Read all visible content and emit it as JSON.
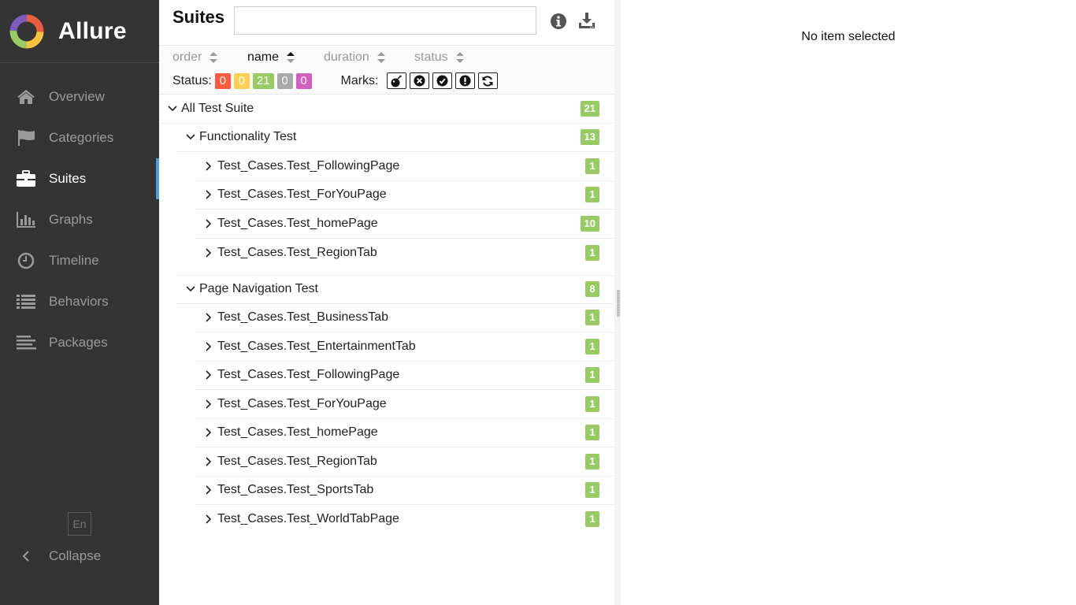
{
  "app": {
    "name": "Allure"
  },
  "sidebar": {
    "items": [
      {
        "label": "Overview",
        "icon": "home-icon",
        "active": false
      },
      {
        "label": "Categories",
        "icon": "flag-icon",
        "active": false
      },
      {
        "label": "Suites",
        "icon": "briefcase-icon",
        "active": true
      },
      {
        "label": "Graphs",
        "icon": "bar-chart-icon",
        "active": false
      },
      {
        "label": "Timeline",
        "icon": "clock-icon",
        "active": false
      },
      {
        "label": "Behaviors",
        "icon": "list-icon",
        "active": false
      },
      {
        "label": "Packages",
        "icon": "align-left-icon",
        "active": false
      }
    ],
    "language": "En",
    "collapse_label": "Collapse"
  },
  "suites": {
    "title": "Suites",
    "search": {
      "value": "",
      "placeholder": ""
    },
    "sort": [
      {
        "label": "order",
        "active": false
      },
      {
        "label": "name",
        "active": true
      },
      {
        "label": "duration",
        "active": false
      },
      {
        "label": "status",
        "active": false
      }
    ],
    "status_label": "Status:",
    "status_counts": [
      {
        "name": "failed",
        "value": "0",
        "color": "#fd5a3e"
      },
      {
        "name": "broken",
        "value": "0",
        "color": "#ffd050"
      },
      {
        "name": "passed",
        "value": "21",
        "color": "#97cc64"
      },
      {
        "name": "skipped",
        "value": "0",
        "color": "#aaaaaa"
      },
      {
        "name": "unknown",
        "value": "0",
        "color": "#d35ebe"
      }
    ],
    "marks_label": "Marks:",
    "marks": [
      "bomb-icon",
      "times-circle-icon",
      "check-circle-icon",
      "exclamation-circle-icon",
      "refresh-icon"
    ],
    "tree": {
      "root": {
        "label": "All Test Suite",
        "count": "21"
      },
      "groups": [
        {
          "label": "Functionality Test",
          "count": "13",
          "children": [
            {
              "label": "Test_Cases.Test_FollowingPage",
              "count": "1"
            },
            {
              "label": "Test_Cases.Test_ForYouPage",
              "count": "1"
            },
            {
              "label": "Test_Cases.Test_homePage",
              "count": "10"
            },
            {
              "label": "Test_Cases.Test_RegionTab",
              "count": "1"
            }
          ]
        },
        {
          "label": "Page Navigation Test",
          "count": "8",
          "children": [
            {
              "label": "Test_Cases.Test_BusinessTab",
              "count": "1"
            },
            {
              "label": "Test_Cases.Test_EntertainmentTab",
              "count": "1"
            },
            {
              "label": "Test_Cases.Test_FollowingPage",
              "count": "1"
            },
            {
              "label": "Test_Cases.Test_ForYouPage",
              "count": "1"
            },
            {
              "label": "Test_Cases.Test_homePage",
              "count": "1"
            },
            {
              "label": "Test_Cases.Test_RegionTab",
              "count": "1"
            },
            {
              "label": "Test_Cases.Test_SportsTab",
              "count": "1"
            },
            {
              "label": "Test_Cases.Test_WorldTabPage",
              "count": "1"
            }
          ]
        }
      ]
    }
  },
  "detail": {
    "empty_text": "No item selected"
  },
  "colors": {
    "sidebar_bg": "#343434",
    "accent": "#4d9de0",
    "passed": "#97cc64"
  }
}
